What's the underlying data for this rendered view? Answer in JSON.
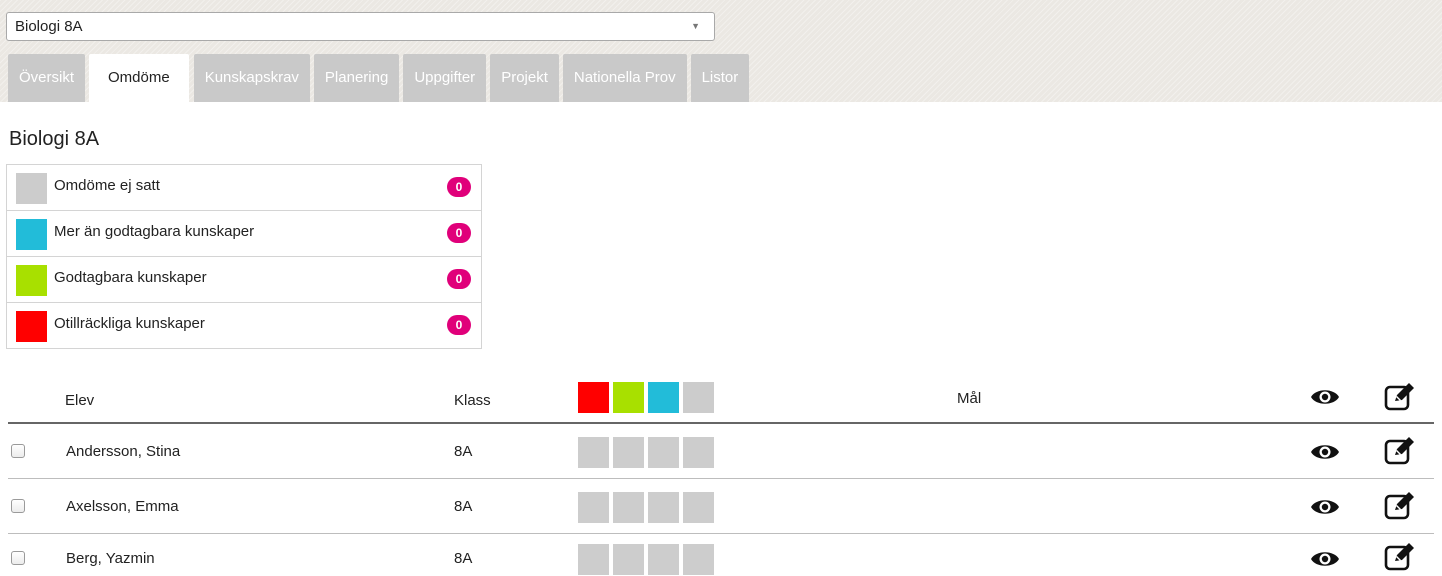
{
  "selector": {
    "value": "Biologi 8A",
    "arrow": "▼"
  },
  "tabs": [
    {
      "label": "Översikt",
      "active": false
    },
    {
      "label": "Omdöme",
      "active": true
    },
    {
      "label": "Kunskapskrav",
      "active": false
    },
    {
      "label": "Planering",
      "active": false
    },
    {
      "label": "Uppgifter",
      "active": false
    },
    {
      "label": "Projekt",
      "active": false
    },
    {
      "label": "Nationella Prov",
      "active": false
    },
    {
      "label": "Listor",
      "active": false
    }
  ],
  "page_title": "Biologi 8A",
  "legend": [
    {
      "label": "Omdöme ej satt",
      "count": "0",
      "color": "#cccccc"
    },
    {
      "label": "Mer än godtagbara kunskaper",
      "count": "0",
      "color": "#22bcd9"
    },
    {
      "label": "Godtagbara kunskaper",
      "count": "0",
      "color": "#a8e000"
    },
    {
      "label": "Otillräckliga kunskaper",
      "count": "0",
      "color": "#ff0000"
    }
  ],
  "table": {
    "headers": {
      "student": "Elev",
      "class": "Klass",
      "goal": "Mål"
    },
    "header_colors": [
      "#ff0000",
      "#a8e000",
      "#22bcd9",
      "#cccccc"
    ],
    "rows": [
      {
        "name": "Andersson, Stina",
        "class": "8A"
      },
      {
        "name": "Axelsson, Emma",
        "class": "8A"
      },
      {
        "name": "Berg, Yazmin",
        "class": "8A"
      }
    ]
  },
  "icons": {
    "view": "eye-icon",
    "edit": "edit-icon"
  }
}
